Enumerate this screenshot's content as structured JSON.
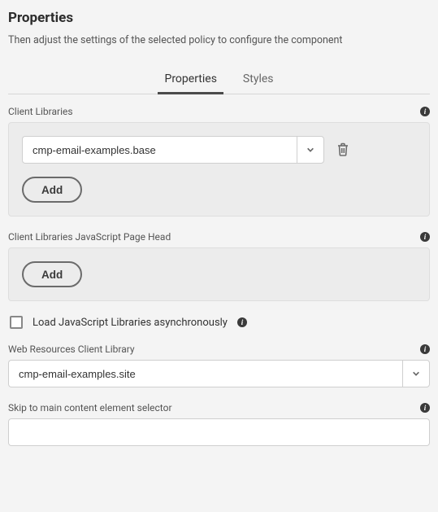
{
  "header": {
    "title": "Properties",
    "subtitle": "Then adjust the settings of the selected policy to configure the component"
  },
  "tabs": {
    "properties": "Properties",
    "styles": "Styles"
  },
  "labels": {
    "client_libraries": "Client Libraries",
    "client_libraries_js_head": "Client Libraries JavaScript Page Head",
    "load_async": "Load JavaScript Libraries asynchronously",
    "web_resources": "Web Resources Client Library",
    "skip_selector": "Skip to main content element selector",
    "add": "Add"
  },
  "values": {
    "client_library_0": "cmp-email-examples.base",
    "web_resources": "cmp-email-examples.site",
    "skip_selector": ""
  }
}
